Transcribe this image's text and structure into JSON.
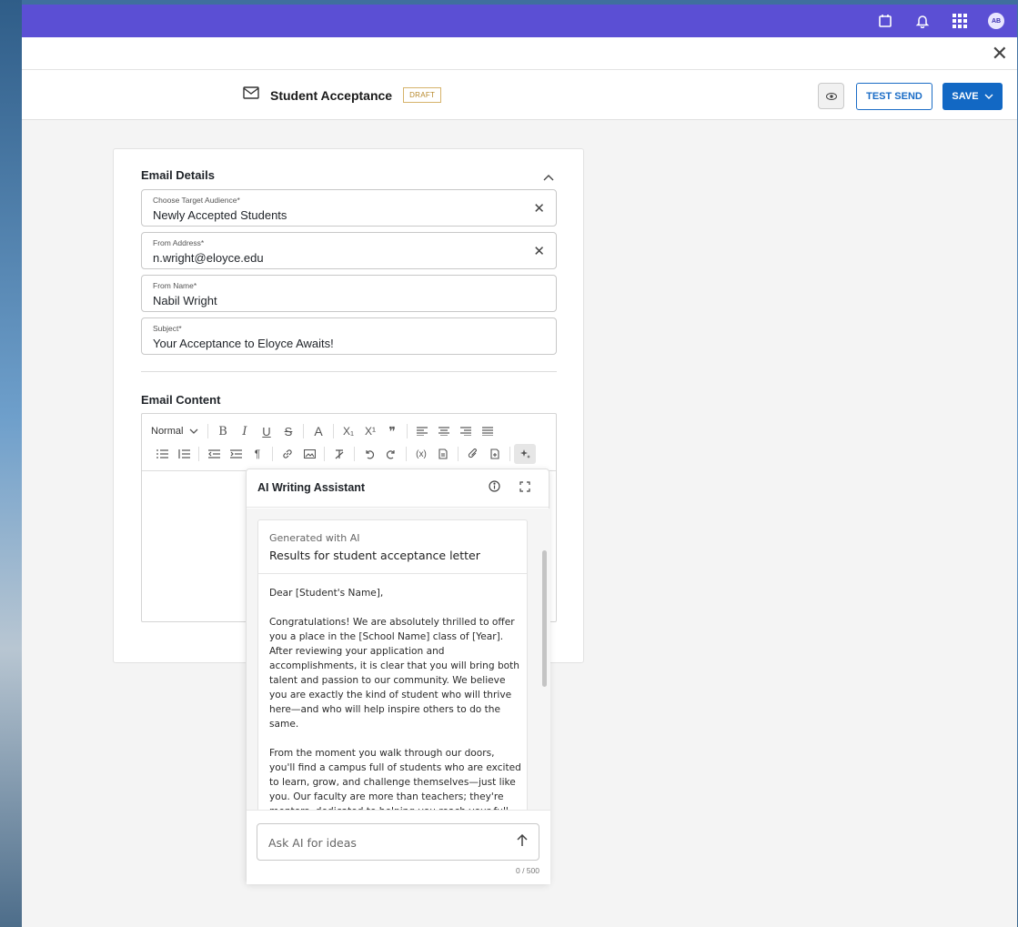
{
  "topbar": {
    "avatar_initials": "AB"
  },
  "header": {
    "title": "Student Acceptance",
    "status_badge": "DRAFT",
    "test_send_label": "TEST SEND",
    "save_label": "SAVE"
  },
  "details": {
    "section_title": "Email Details",
    "fields": [
      {
        "label": "Choose Target Audience*",
        "value": "Newly Accepted Students"
      },
      {
        "label": "From Address*",
        "value": "n.wright@eloyce.edu"
      },
      {
        "label": "From Name*",
        "value": "Nabil Wright"
      },
      {
        "label": "Subject*",
        "value": "Your Acceptance to Eloyce Awaits!"
      }
    ]
  },
  "content": {
    "section_title": "Email Content",
    "format_select": "Normal"
  },
  "ai": {
    "title": "AI Writing Assistant",
    "generated_label": "Generated with AI",
    "result_title": "Results for student acceptance letter",
    "letter": [
      "Dear [Student's Name],",
      "Congratulations! We are absolutely thrilled to offer you a place in the [School Name] class of [Year]. After reviewing your application and accomplishments, it is clear that you will bring both talent and passion to our community. We believe you are exactly the kind of student who will thrive here—and who will help inspire others to do the same.",
      "From the moment you walk through our doors, you'll find a campus full of students who are excited to learn, grow, and challenge themselves—just like you. Our faculty are more than teachers; they're mentors, dedicated to helping you reach your full potential. Whether you're looking to explore new subjects, dive"
    ],
    "input_placeholder": "Ask AI for ideas",
    "char_count": "0 / 500"
  },
  "colors": {
    "topbar": "#5b4fd4",
    "primary": "#1268c4",
    "badge": "#b7882b"
  }
}
